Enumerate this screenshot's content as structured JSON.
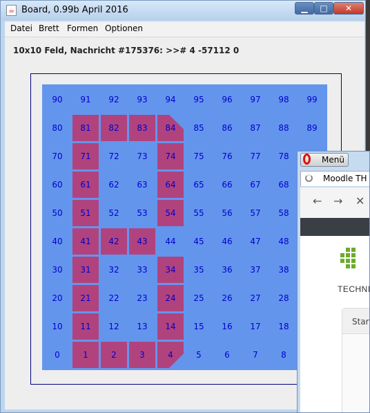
{
  "window": {
    "title": "Board, 0.99b April 2016",
    "buttons": {
      "minimize": "▁",
      "maximize": "□",
      "close": "✕"
    }
  },
  "menu": [
    "Datei",
    "Brett",
    "Formen",
    "Optionen"
  ],
  "status": "10x10 Feld, Nachricht #175376: >># 4 -57112 0",
  "board": {
    "rows": 10,
    "cols": 10,
    "background": "#6495ed",
    "highlight": "#b0437e",
    "text_color": "#0000cc",
    "highlighted_cells": [
      81,
      82,
      83,
      71,
      74,
      61,
      64,
      51,
      54,
      41,
      42,
      43,
      31,
      34,
      21,
      24,
      11,
      14,
      1,
      2,
      3
    ],
    "triangle_cells": {
      "84": "top-left",
      "4": "bottom-left"
    }
  },
  "browser": {
    "menu_label": "Menü",
    "tab_title": "Moodle TH M",
    "nav": {
      "back": "←",
      "forward": "→",
      "stop": "✕"
    },
    "page_text": "TECHNISC",
    "card_label": "Start"
  }
}
